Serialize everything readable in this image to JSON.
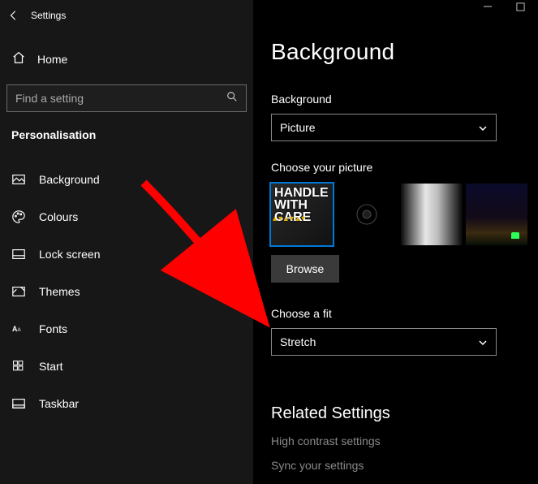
{
  "window": {
    "title": "Settings"
  },
  "home": {
    "label": "Home"
  },
  "search": {
    "placeholder": "Find a setting"
  },
  "category": "Personalisation",
  "nav": [
    {
      "label": "Background"
    },
    {
      "label": "Colours"
    },
    {
      "label": "Lock screen"
    },
    {
      "label": "Themes"
    },
    {
      "label": "Fonts"
    },
    {
      "label": "Start"
    },
    {
      "label": "Taskbar"
    }
  ],
  "page": {
    "title": "Background",
    "bg_label": "Background",
    "bg_value": "Picture",
    "choose_picture_label": "Choose your picture",
    "browse_label": "Browse",
    "fit_label": "Choose a fit",
    "fit_value": "Stretch",
    "related_title": "Related Settings",
    "related_links": [
      "High contrast settings",
      "Sync your settings"
    ]
  }
}
